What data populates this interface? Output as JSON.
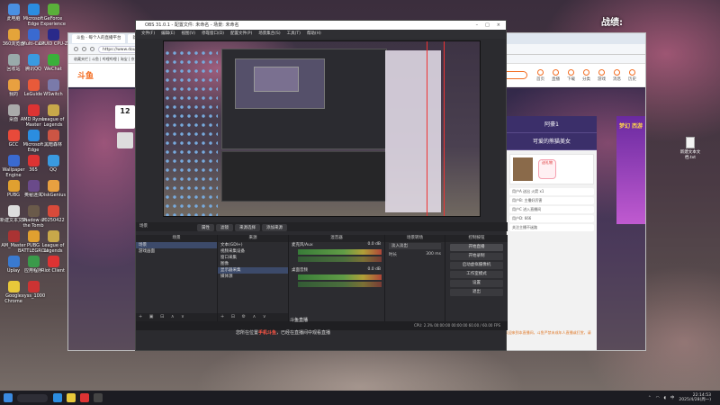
{
  "desktop": {
    "top_right_label": "战绩:",
    "icons_left": [
      {
        "label": "此电脑",
        "color": "#4a90e2"
      },
      {
        "label": "Microsoft Edge",
        "color": "#2b8de0"
      },
      {
        "label": "GeForce Experience",
        "color": "#5ab03a"
      },
      {
        "label": "360浏览器",
        "color": "#e4a43a"
      },
      {
        "label": "Multi-Cast",
        "color": "#3a6ad0"
      },
      {
        "label": "CPUID CPU-Z",
        "color": "#2a2a8a"
      },
      {
        "label": "回收站",
        "color": "#9aa"
      },
      {
        "label": "腾讯QQ",
        "color": "#3a9ae0"
      },
      {
        "label": "WeChat",
        "color": "#3ab03a"
      },
      {
        "label": "我的",
        "color": "#e8a040"
      },
      {
        "label": "LeGuide",
        "color": "#e85a3a"
      },
      {
        "label": "WSwitch",
        "color": "#7a7aaa"
      },
      {
        "label": "桌面",
        "color": "#aaa"
      },
      {
        "label": "AMD Ryzen Master",
        "color": "#d33"
      },
      {
        "label": "League of Legends",
        "color": "#c8a84a"
      },
      {
        "label": "GCC",
        "color": "#e84a3a"
      },
      {
        "label": "Microsoft Edge",
        "color": "#2b8de0"
      },
      {
        "label": "黑暗森林",
        "color": "#c54"
      },
      {
        "label": "Wallpaper Engine",
        "color": "#3a6ad0"
      },
      {
        "label": "365",
        "color": "#d33"
      },
      {
        "label": "QQ",
        "color": "#3a9ae0"
      },
      {
        "label": "PUBG",
        "color": "#e0a030"
      },
      {
        "label": "奥秘迷失",
        "color": "#6a4a8a"
      },
      {
        "label": "DiskGenius",
        "color": "#e8a040"
      },
      {
        "label": "新建文本文档",
        "color": "#ddd"
      },
      {
        "label": "Shadow of the Tomb",
        "color": "#6a5a4a"
      },
      {
        "label": "20250422",
        "color": "#d84a3a"
      },
      {
        "label": "AM_Master",
        "color": "#a33"
      },
      {
        "label": "PUBG BATTLEGROUNDS",
        "color": "#e0a030"
      },
      {
        "label": "League of Legends",
        "color": "#c8a84a"
      },
      {
        "label": "Uplay",
        "color": "#3a7ad0"
      },
      {
        "label": "应用程序",
        "color": "#3a9a4a"
      },
      {
        "label": "Riot Client",
        "color": "#d33"
      },
      {
        "label": "Google Chrome",
        "color": "#e8c83a"
      },
      {
        "label": "xyss_1000",
        "color": "#c33"
      }
    ],
    "file_icon_label": "新建文本文档.txt"
  },
  "browser": {
    "tabs": [
      "斗鱼 - 每个人的直播平台",
      "新标签页"
    ],
    "url": "https://www.douyu.com/",
    "bookmarks": "收藏夹栏  |  斗鱼  |  哔哩哔哩  |  淘宝  |  京东",
    "logo": "斗鱼",
    "topnav": [
      "首页",
      "直播",
      "下载",
      "分类",
      "游戏",
      "消息",
      "历史"
    ],
    "streamer_badge": "12",
    "side_panel": {
      "title": "阿豪1",
      "subtitle": "可爱的熊猫美女",
      "gift_btn": "送礼物",
      "rows": [
        "用户A 送出 火箭 x1",
        "用户B: 主播好厉害",
        "用户C 进入直播间",
        "用户D: 666",
        "关注主播不迷路"
      ]
    },
    "chat_notice": "系统提示: 欢迎来到本直播间，斗鱼严禁未成年人直播或打赏，请理性消费。",
    "ad_text": "梦幻 西游"
  },
  "obs": {
    "title": "OBS 31.0.1 - 配置文件: 未命名 - 场景: 未命名",
    "menu": [
      "文件(F)",
      "编辑(E)",
      "视图(V)",
      "停靠窗口(D)",
      "配置文件(P)",
      "场景集合(S)",
      "工具(T)",
      "帮助(H)"
    ],
    "scene_bar": "场景",
    "toolbar_tabs": [
      "属性",
      "滤镜",
      "来源选择",
      "添加来源"
    ],
    "docks": {
      "scenes": {
        "header": "场景",
        "items": [
          "场景",
          "游戏画面"
        ]
      },
      "sources": {
        "header": "来源",
        "items": [
          "文本(GDI+)",
          "视频采集设备",
          "窗口采集",
          "图像",
          "显示器采集",
          "媒体源"
        ]
      },
      "mixer": {
        "header": "混音器",
        "channels": [
          {
            "name": "麦克风/Aux",
            "db": "0.0 dB"
          },
          {
            "name": "桌面音频",
            "db": "0.0 dB"
          }
        ]
      },
      "transitions": {
        "header": "场景转场",
        "type": "淡入淡出",
        "duration_label": "时长",
        "duration": "300 ms"
      },
      "controls": {
        "header": "控制按钮",
        "buttons": [
          "开始直播",
          "开始录制",
          "启动虚拟摄像机",
          "工作室模式",
          "设置",
          "退出"
        ]
      }
    },
    "status": "CPU: 2.3%  00:00:00  00:00:00  60.00 / 60.00 FPS"
  },
  "overlay": {
    "title": "斗鱼直播",
    "text_prefix": "您所在位置",
    "text_highlight": "手机斗鱼",
    "text_suffix": "，已经在直播间中观看直播"
  },
  "taskbar": {
    "icons": [
      {
        "color": "#3a8ae0"
      },
      {
        "color": "#2b8de0"
      },
      {
        "color": "#e8c83a"
      },
      {
        "color": "#d33"
      },
      {
        "color": "#444"
      }
    ],
    "time": "22:14:53",
    "date": "2025/4/28(周一)",
    "lang": "中"
  }
}
